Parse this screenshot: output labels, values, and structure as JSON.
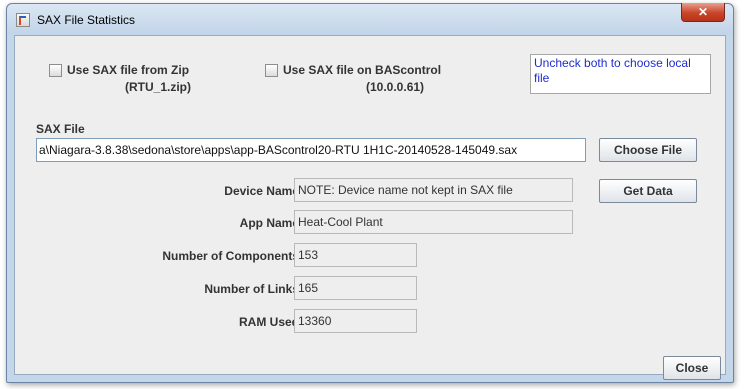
{
  "window": {
    "title": "SAX File Statistics",
    "close_glyph": "✕"
  },
  "options": {
    "zip": {
      "label": "Use SAX file from Zip",
      "detail": "(RTU_1.zip)"
    },
    "bascontrol": {
      "label": "Use SAX file on BAScontrol",
      "detail": "(10.0.0.61)"
    }
  },
  "note": "Uncheck both to choose local file",
  "sax_file": {
    "label": "SAX File",
    "path": "a\\Niagara-3.8.38\\sedona\\store\\apps\\app-BAScontrol20-RTU 1H1C-20140528-145049.sax"
  },
  "buttons": {
    "choose_file": "Choose File",
    "get_data": "Get Data",
    "close": "Close"
  },
  "fields": {
    "device_name": {
      "label": "Device Name",
      "value": "NOTE: Device name not kept in SAX file"
    },
    "app_name": {
      "label": "App Name",
      "value": "Heat-Cool Plant"
    },
    "components": {
      "label": "Number of Components",
      "value": "153"
    },
    "links": {
      "label": "Number of Links",
      "value": "165"
    },
    "ram": {
      "label": "RAM Used",
      "value": "13360"
    }
  },
  "colors": {
    "note_text": "#1f2ccf",
    "close_button": "#c9452a"
  }
}
